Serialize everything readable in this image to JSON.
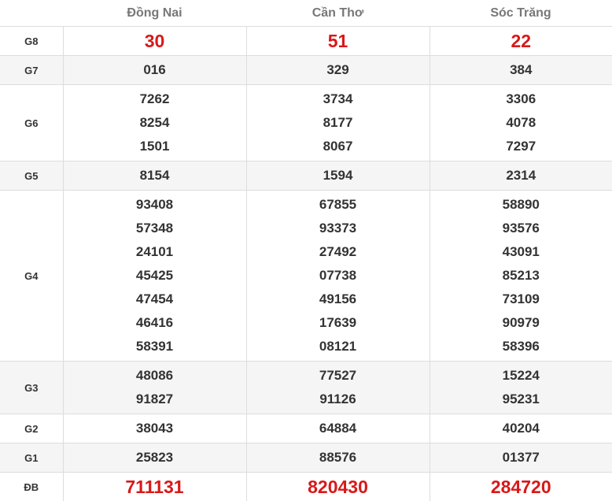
{
  "columns": [
    "Đồng Nai",
    "Cần Thơ",
    "Sóc Trăng"
  ],
  "accent_red": "#d81919",
  "rows": [
    {
      "label": "G8",
      "highlight": true,
      "values": [
        [
          "30"
        ],
        [
          "51"
        ],
        [
          "22"
        ]
      ]
    },
    {
      "label": "G7",
      "values": [
        [
          "016"
        ],
        [
          "329"
        ],
        [
          "384"
        ]
      ]
    },
    {
      "label": "G6",
      "values": [
        [
          "7262",
          "8254",
          "1501"
        ],
        [
          "3734",
          "8177",
          "8067"
        ],
        [
          "3306",
          "4078",
          "7297"
        ]
      ]
    },
    {
      "label": "G5",
      "values": [
        [
          "8154"
        ],
        [
          "1594"
        ],
        [
          "2314"
        ]
      ]
    },
    {
      "label": "G4",
      "values": [
        [
          "93408",
          "57348",
          "24101",
          "45425",
          "47454",
          "46416",
          "58391"
        ],
        [
          "67855",
          "93373",
          "27492",
          "07738",
          "49156",
          "17639",
          "08121"
        ],
        [
          "58890",
          "93576",
          "43091",
          "85213",
          "73109",
          "90979",
          "58396"
        ]
      ]
    },
    {
      "label": "G3",
      "values": [
        [
          "48086",
          "91827"
        ],
        [
          "77527",
          "91126"
        ],
        [
          "15224",
          "95231"
        ]
      ]
    },
    {
      "label": "G2",
      "values": [
        [
          "38043"
        ],
        [
          "64884"
        ],
        [
          "40204"
        ]
      ]
    },
    {
      "label": "G1",
      "values": [
        [
          "25823"
        ],
        [
          "88576"
        ],
        [
          "01377"
        ]
      ]
    },
    {
      "label": "ĐB",
      "highlight": true,
      "values": [
        [
          "711131"
        ],
        [
          "820430"
        ],
        [
          "284720"
        ]
      ]
    }
  ]
}
